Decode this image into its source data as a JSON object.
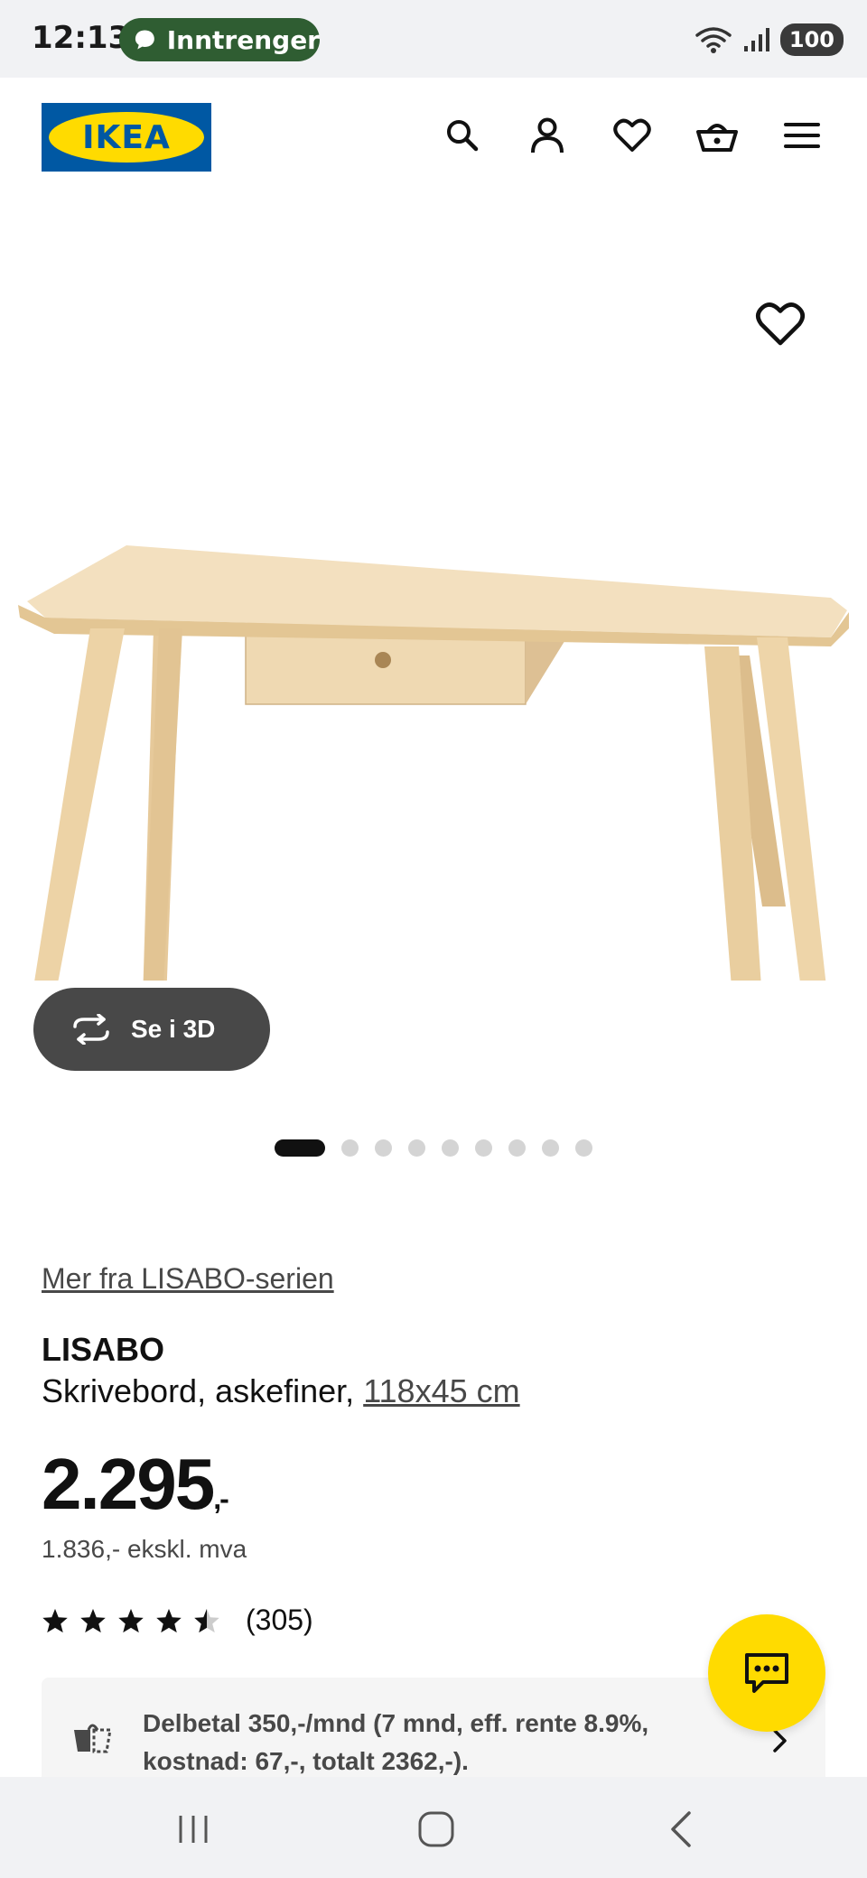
{
  "status_bar": {
    "time": "12:13",
    "pill_label": "Inntrenger",
    "battery": "100",
    "pill_color": "#2f5d32"
  },
  "header": {
    "logo_text": "IKEA",
    "icons": [
      "search-icon",
      "account-icon",
      "heart-icon",
      "basket-icon",
      "menu-icon"
    ],
    "brand_blue": "#0058a3",
    "brand_yellow": "#ffdb00"
  },
  "gallery": {
    "view_3d_label": "Se i 3D",
    "total_images": 9,
    "active_index": 0
  },
  "product": {
    "series_link": "Mer fra LISABO-serien",
    "name": "LISABO",
    "description": "Skrivebord, askefiner,",
    "size": "118x45 cm",
    "price_main": "2.295",
    "price_suffix": ",-",
    "price_ex_vat": "1.836,- ekskl. mva",
    "rating_stars": 4.5,
    "rating_count": "(305)"
  },
  "finance": {
    "text": "Delbetal 350,-/mnd (7 mnd, eff. rente 8.9%, kostnad: 67,-, totalt 2362,-)."
  },
  "chat": {
    "icon": "chat-icon"
  },
  "nav_bar": {
    "buttons": [
      "recent-apps",
      "home",
      "back"
    ]
  }
}
